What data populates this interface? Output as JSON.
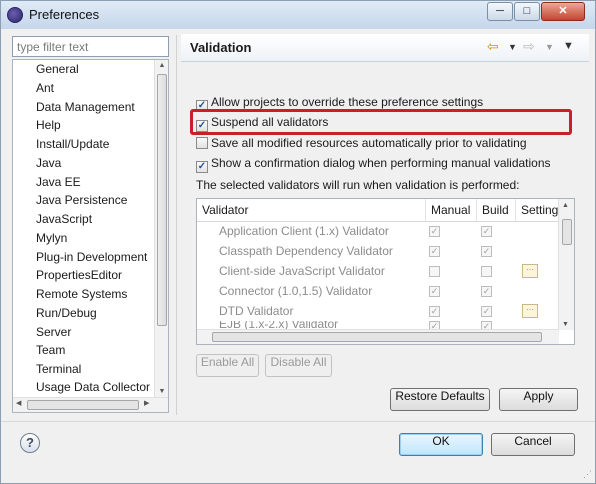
{
  "window": {
    "title": "Preferences",
    "buttons": [
      "─",
      "□",
      "✕"
    ]
  },
  "filter": {
    "placeholder": "type filter text"
  },
  "tree": {
    "items": [
      "General",
      "Ant",
      "Data Management",
      "Help",
      "Install/Update",
      "Java",
      "Java EE",
      "Java Persistence",
      "JavaScript",
      "Mylyn",
      "Plug-in Development",
      "PropertiesEditor",
      "Remote Systems",
      "Run/Debug",
      "Server",
      "Team",
      "Terminal",
      "Usage Data Collector"
    ]
  },
  "page": {
    "title": "Validation",
    "nav": {
      "back_icon": "back-arrow-icon",
      "forward_icon": "forward-arrow-icon",
      "menu_icon": "view-menu-icon"
    }
  },
  "options": [
    {
      "label": "Allow projects to override these preference settings",
      "checked": true
    },
    {
      "label": "Suspend all validators",
      "checked": true
    },
    {
      "label": "Save all modified resources automatically prior to validating",
      "checked": false
    },
    {
      "label": "Show a confirmation dialog when performing manual validations",
      "checked": true
    }
  ],
  "selected_note": "The selected validators will run when validation is performed:",
  "table": {
    "headers": [
      "Validator",
      "Manual",
      "Build",
      "Settings"
    ],
    "rows": [
      {
        "name": "Application Client (1.x) Validator",
        "manual": true,
        "build": true,
        "settings": false
      },
      {
        "name": "Classpath Dependency Validator",
        "manual": true,
        "build": true,
        "settings": false
      },
      {
        "name": "Client-side JavaScript Validator",
        "manual": false,
        "build": false,
        "settings": true
      },
      {
        "name": "Connector (1.0,1.5) Validator",
        "manual": true,
        "build": true,
        "settings": false
      },
      {
        "name": "DTD Validator",
        "manual": true,
        "build": true,
        "settings": true
      },
      {
        "name": "EJB (1.x-2.x) Validator",
        "manual": true,
        "build": true,
        "settings": false
      }
    ]
  },
  "buttons": {
    "enable_all": "Enable All",
    "disable_all": "Disable All",
    "restore_defaults": "Restore Defaults",
    "apply": "Apply",
    "ok": "OK",
    "cancel": "Cancel",
    "help": "?"
  },
  "colors": {
    "highlight": "#c8202a",
    "accent": "#3c7fb1"
  }
}
